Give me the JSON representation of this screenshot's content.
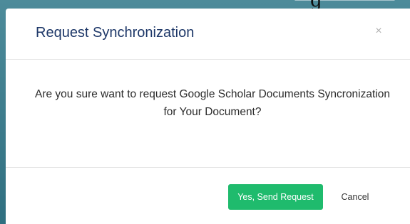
{
  "background": {
    "partial_text": "g",
    "color": "#3d7e8e"
  },
  "modal": {
    "title": "Request Synchronization",
    "close_symbol": "×",
    "message": "Are you sure want to request Google Scholar Documents Syncronization for Your Document?",
    "confirm_label": "Yes, Send Request",
    "cancel_label": "Cancel",
    "colors": {
      "title": "#1d3768",
      "confirm_bg": "#1fbb6d",
      "confirm_text": "#ffffff"
    }
  }
}
